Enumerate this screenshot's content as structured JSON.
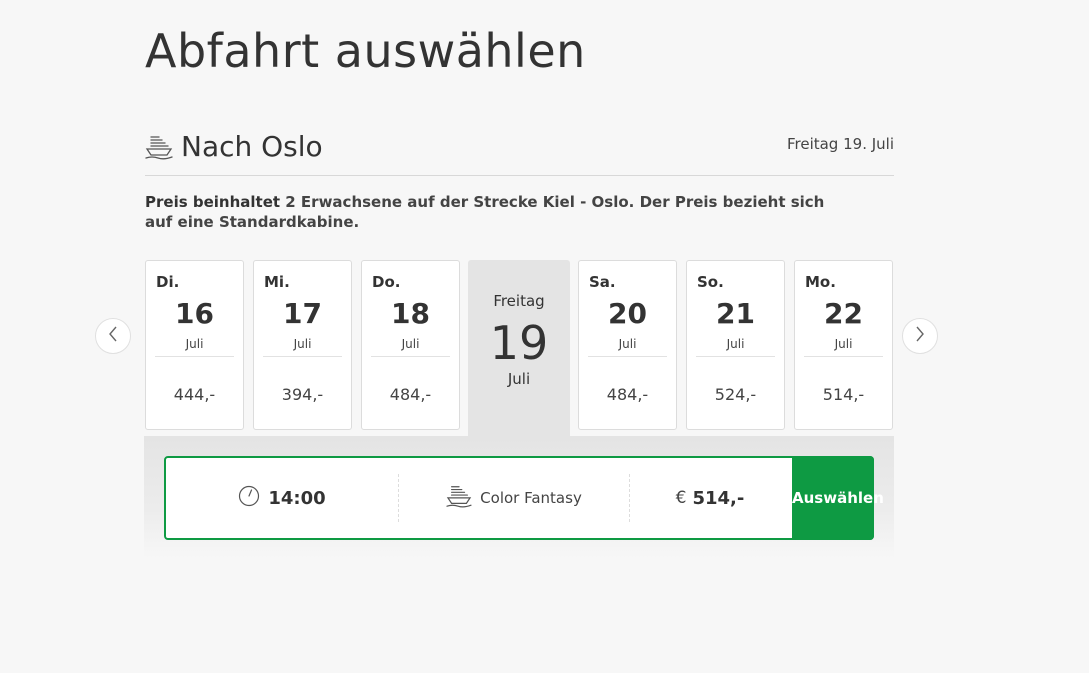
{
  "page": {
    "title": "Abfahrt auswählen"
  },
  "route": {
    "title": "Nach Oslo",
    "date": "Freitag 19. Juli",
    "icon": "ship-icon"
  },
  "price_note": {
    "strong": "Preis beinhaltet",
    "rest": " 2 Erwachsene auf der Strecke Kiel - Oslo. Der Preis bezieht sich auf eine Standardkabine."
  },
  "days": [
    {
      "dow": "Di.",
      "num": "16",
      "month": "Juli",
      "price": "444,-"
    },
    {
      "dow": "Mi.",
      "num": "17",
      "month": "Juli",
      "price": "394,-"
    },
    {
      "dow": "Do.",
      "num": "18",
      "month": "Juli",
      "price": "484,-"
    },
    {
      "dow": "Sa.",
      "num": "20",
      "month": "Juli",
      "price": "484,-"
    },
    {
      "dow": "So.",
      "num": "21",
      "month": "Juli",
      "price": "524,-"
    },
    {
      "dow": "Mo.",
      "num": "22",
      "month": "Juli",
      "price": "514,-"
    }
  ],
  "selected_day": {
    "dow": "Freitag",
    "num": "19",
    "month": "Juli"
  },
  "departure": {
    "time": "14:00",
    "ship": "Color Fantasy",
    "currency": "€",
    "price": "514,-",
    "select_label": "Auswählen"
  },
  "colors": {
    "accent": "#0e9a43",
    "selected_bg": "#e4e4e4",
    "background": "#f7f7f7"
  }
}
